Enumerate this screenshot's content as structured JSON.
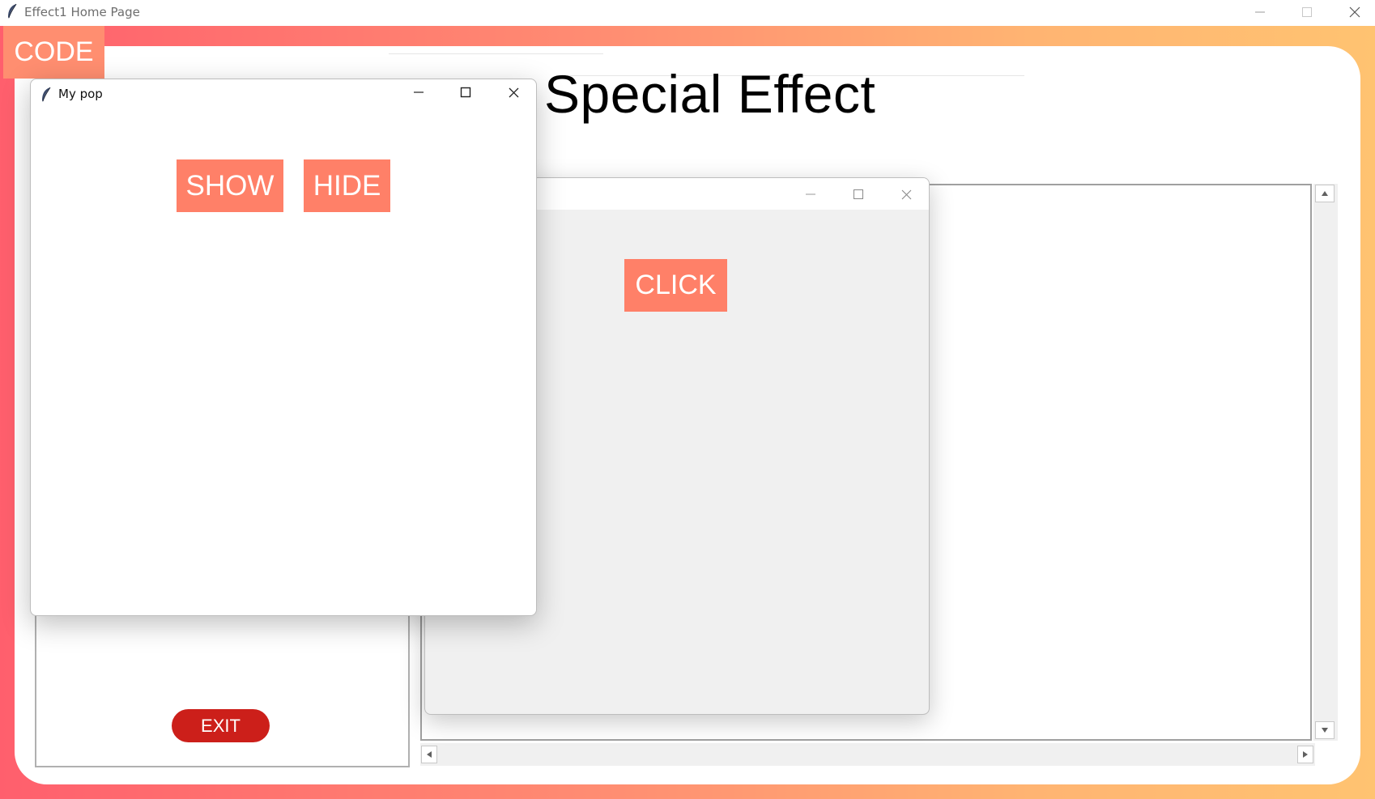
{
  "main_window": {
    "title": "Effect1 Home Page",
    "icon": "feather-icon",
    "controls": [
      "minimize-icon",
      "maximize-icon",
      "close-icon"
    ]
  },
  "code_label": "CODE",
  "heading": "Special Effect",
  "exit_label": "EXIT",
  "popup_click": {
    "title": "",
    "button_label": "CLICK"
  },
  "popup_mypop": {
    "title": "My pop",
    "icon": "feather-icon",
    "show_label": "SHOW",
    "hide_label": "HIDE"
  },
  "colors": {
    "frame_gradient": [
      "#ff5f6d",
      "#ffc371"
    ],
    "button_salmon": "#ff8068",
    "exit_red": "#cc1f1a"
  }
}
